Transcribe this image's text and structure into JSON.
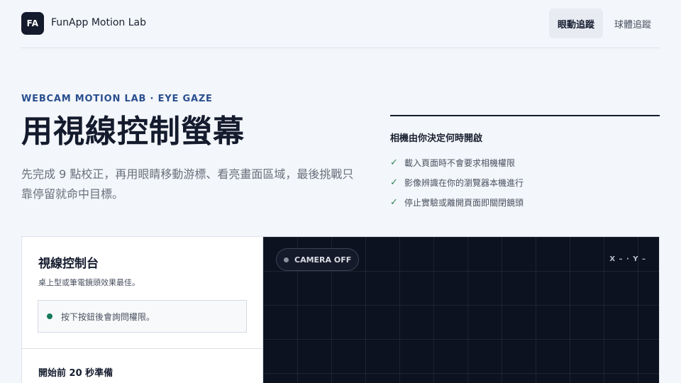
{
  "header": {
    "logo": "FA",
    "brand": "FunApp Motion Lab",
    "nav": [
      {
        "label": "眼動追蹤",
        "active": true
      },
      {
        "label": "球體追蹤",
        "active": false
      }
    ]
  },
  "hero": {
    "eyebrow": "WEBCAM MOTION LAB · EYE GAZE",
    "title": "用視線控制螢幕",
    "description": "先完成 9 點校正，再用眼睛移動游標、看亮畫面區域，最後挑戰只靠停留就命中目標。"
  },
  "info": {
    "title": "相機由你決定何時開啟",
    "items": [
      "載入頁面時不會要求相機權限",
      "影像辨識在你的瀏覽器本機進行",
      "停止實驗或離開頁面即關閉鏡頭"
    ]
  },
  "console": {
    "title": "視線控制台",
    "subtitle": "桌上型或筆電鏡頭效果最佳。",
    "status": "按下按鈕後會詢問權限。",
    "prep": "開始前 20 秒準備"
  },
  "viewer": {
    "camera_label": "CAMERA OFF",
    "coords": "X – · Y –"
  },
  "colors": {
    "accent": "#2a4f8f",
    "dark": "#141b2d",
    "check": "#2e8a57",
    "status_dot": "#167a5a"
  }
}
